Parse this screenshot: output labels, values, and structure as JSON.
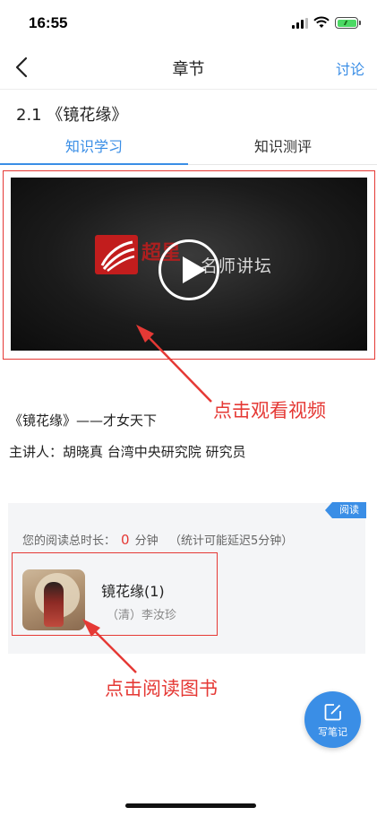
{
  "status_bar": {
    "time": "16:55"
  },
  "nav": {
    "title": "章节",
    "discuss": "讨论"
  },
  "section": {
    "title": "2.1 《镜花缘》"
  },
  "tabs": [
    {
      "label": "知识学习",
      "active": true
    },
    {
      "label": "知识测评",
      "active": false
    }
  ],
  "video": {
    "overlay_text": "名师讲坛",
    "logo_text": "超星"
  },
  "annotations": {
    "video": "点击观看视频",
    "book": "点击阅读图书"
  },
  "description": {
    "line1": "《镜花缘》——才女天下",
    "line2": "主讲人：胡晓真  台湾中央研究院  研究员"
  },
  "reading": {
    "badge": "阅读",
    "stat_prefix": "您的阅读总时长：",
    "minutes": "0",
    "stat_unit": "分钟",
    "stat_note": "（统计可能延迟5分钟）",
    "book": {
      "title": "镜花缘(1)",
      "author": "（清）李汝珍"
    }
  },
  "note_button": {
    "label": "写笔记"
  },
  "colors": {
    "accent": "#3a8ee6",
    "annotation": "#e53935",
    "card_bg": "#f4f5f7"
  }
}
